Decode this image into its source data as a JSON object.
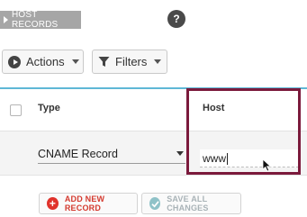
{
  "section": {
    "title": "HOST RECORDS"
  },
  "help": {
    "glyph": "?"
  },
  "toolbar": {
    "actions_label": "Actions",
    "filters_label": "Filters"
  },
  "table": {
    "columns": [
      "Type",
      "Host"
    ],
    "rows": [
      {
        "type": "CNAME Record",
        "host": "www"
      }
    ]
  },
  "buttons": {
    "add_new_record": "ADD NEW RECORD",
    "save_all_changes": "SAVE ALL CHANGES"
  },
  "colors": {
    "accent_rule": "#5fb7d6",
    "highlight_box": "#7b1a3c",
    "add_red": "#e0322b",
    "save_teal": "#8fc2c8"
  },
  "icons": [
    "play-circle-icon",
    "funnel-icon",
    "chevron-down-icon",
    "plus-icon",
    "check-icon",
    "help-icon",
    "mouse-cursor-icon"
  ]
}
